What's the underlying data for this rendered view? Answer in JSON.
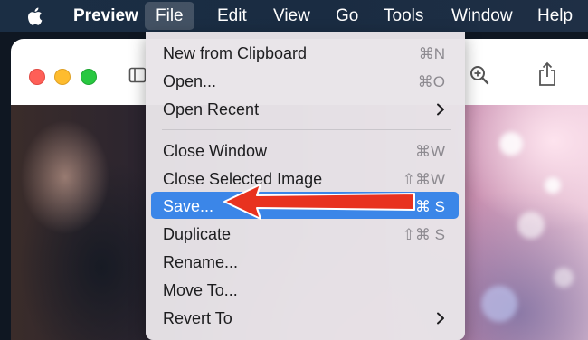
{
  "menubar": {
    "app_name": "Preview",
    "menus": [
      "File",
      "Edit",
      "View",
      "Go",
      "Tools",
      "Window",
      "Help"
    ],
    "active_menu": "File"
  },
  "window": {
    "toolbar_icons": [
      "sidebar-icon",
      "zoom-in-icon",
      "share-icon"
    ]
  },
  "file_menu": {
    "items": [
      {
        "label": "New from Clipboard",
        "shortcut": "⌘N"
      },
      {
        "label": "Open...",
        "shortcut": "⌘O"
      },
      {
        "label": "Open Recent",
        "shortcut": "",
        "submenu": true
      },
      {
        "label": "Close Window",
        "shortcut": "⌘W"
      },
      {
        "label": "Close Selected Image",
        "shortcut": "⇧⌘W"
      },
      {
        "label": "Save...",
        "shortcut": "⌘ S",
        "highlighted": true
      },
      {
        "label": "Duplicate",
        "shortcut": "⇧⌘ S"
      },
      {
        "label": "Rename...",
        "shortcut": ""
      },
      {
        "label": "Move To...",
        "shortcut": ""
      },
      {
        "label": "Revert To",
        "shortcut": "",
        "submenu": true
      }
    ]
  },
  "colors": {
    "highlight": "#3b86e8",
    "annotation_arrow": "#e8321f"
  }
}
